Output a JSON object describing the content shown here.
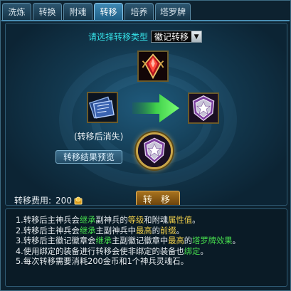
{
  "tabs": [
    {
      "label": "洗炼"
    },
    {
      "label": "转换"
    },
    {
      "label": "附魂"
    },
    {
      "label": "转移",
      "active": true
    },
    {
      "label": "培养"
    },
    {
      "label": "塔罗牌"
    }
  ],
  "transfer_type": {
    "label": "请选择转移类型",
    "selected": "徽记转移"
  },
  "slots": {
    "top": {
      "icon": "red-gem-icon"
    },
    "left": {
      "icon": "blue-card-icon"
    },
    "right": {
      "icon": "silver-badge-icon"
    },
    "bottom": {
      "icon": "silver-badge-icon"
    }
  },
  "lost_label": "(转移后消失)",
  "preview_button": "转移结果预览",
  "cost": {
    "label": "转移费用:",
    "value": "200",
    "icon": "gold-coin-icon"
  },
  "transfer_button": "转 移",
  "notes": [
    [
      "1.转移后主神兵会",
      {
        "t": "继承",
        "c": "g"
      },
      "副神兵的",
      {
        "t": "等级",
        "c": "y"
      },
      "和附魂",
      {
        "t": "属性值",
        "c": "y"
      },
      "。"
    ],
    [
      "2.转移后主神兵会",
      {
        "t": "继承",
        "c": "g"
      },
      "主副神兵中",
      {
        "t": "最高",
        "c": "y"
      },
      "的",
      {
        "t": "前缀",
        "c": "y"
      },
      "。"
    ],
    [
      "3.转移后主徽记徽章会",
      {
        "t": "继承",
        "c": "g"
      },
      "主副徽记徽章中",
      {
        "t": "最高",
        "c": "y"
      },
      "的",
      {
        "t": "塔罗牌效果",
        "c": "g"
      },
      "。"
    ],
    [
      "4.使用绑定的装备进行转移会使非绑定的装备也",
      {
        "t": "绑定",
        "c": "g"
      },
      "。"
    ],
    [
      "5.每次转移需要消耗200金币和1个神兵灵魂石。"
    ]
  ],
  "colors": {
    "accent_cyan": "#36e3e9",
    "highlight_green": "#47e04e",
    "highlight_yellow": "#f2d04a",
    "gold_border": "#c9a64a"
  }
}
